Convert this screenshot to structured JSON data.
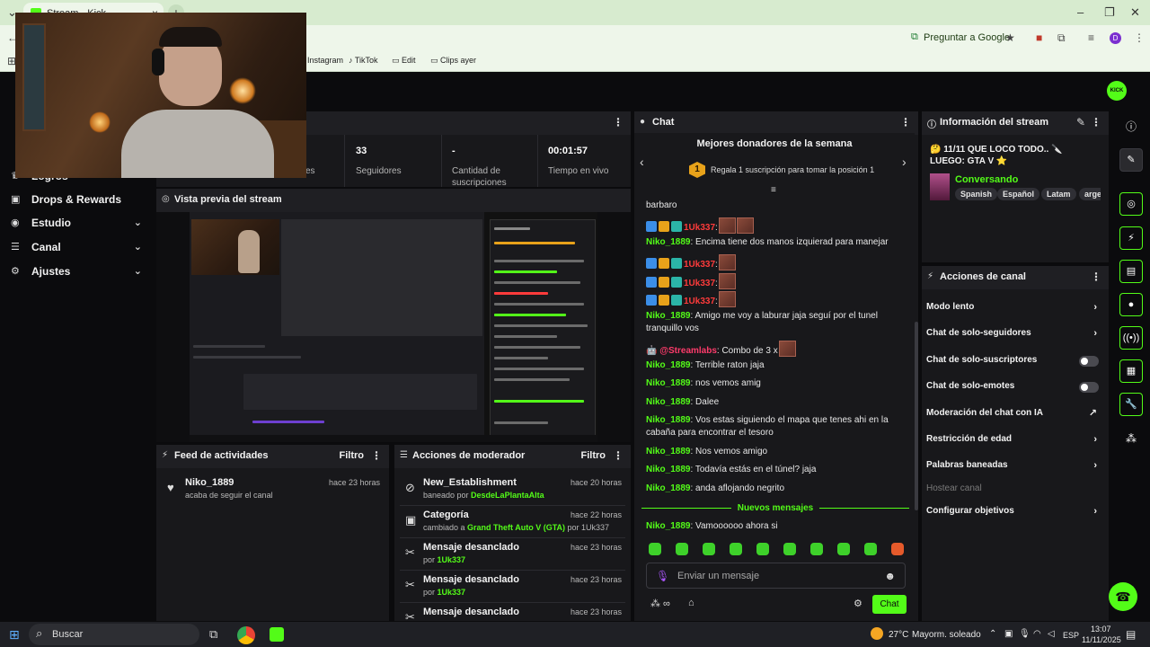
{
  "browser": {
    "tab_title": "Stream - Kick Dashboard",
    "ask_google": "Preguntar a Google",
    "bookmarks": [
      "Instagram",
      "TikTok",
      "Edit",
      "Clips ayer"
    ]
  },
  "sidebar": {
    "items": [
      {
        "label": "Logros",
        "icon": "trophy-icon"
      },
      {
        "label": "Drops & Rewards",
        "icon": "gift-icon"
      },
      {
        "label": "Estudio",
        "icon": "webcam-icon"
      },
      {
        "label": "Canal",
        "icon": "channel-icon"
      },
      {
        "label": "Ajustes",
        "icon": "gear-icon"
      }
    ]
  },
  "stats": [
    {
      "value": "",
      "label": "es"
    },
    {
      "value": "33",
      "label": "Seguidores"
    },
    {
      "value": "-",
      "label": "Cantidad de suscripciones"
    },
    {
      "value": "00:01:57",
      "label": "Tiempo en vivo"
    }
  ],
  "preview": {
    "title": "Vista previa del stream"
  },
  "activity_feed": {
    "title": "Feed de actividades",
    "filter": "Filtro",
    "items": [
      {
        "user": "Niko_1889",
        "text": "acaba de seguir el canal",
        "ago": "hace 23 horas"
      }
    ]
  },
  "moderator": {
    "title": "Acciones de moderador",
    "filter": "Filtro",
    "items": [
      {
        "title": "New_Establishment",
        "prefix": "baneado por ",
        "actor": "DesdeLaPlantaAlta",
        "suffix": "",
        "ago": "hace 20 horas"
      },
      {
        "title": "Categoría",
        "prefix": "cambiado a ",
        "actor": "Grand Theft Auto V (GTA)",
        "suffix": " por 1Uk337",
        "ago": "hace 22 horas"
      },
      {
        "title": "Mensaje desanclado",
        "prefix": "por ",
        "actor": "1Uk337",
        "suffix": "",
        "ago": "hace 23 horas"
      },
      {
        "title": "Mensaje desanclado",
        "prefix": "por ",
        "actor": "1Uk337",
        "suffix": "",
        "ago": "hace 23 horas"
      },
      {
        "title": "Mensaje desanclado",
        "prefix": "",
        "actor": "",
        "suffix": "",
        "ago": "hace 23 horas"
      }
    ]
  },
  "chat": {
    "title": "Chat",
    "donors_title": "Mejores donadores de la semana",
    "donors_msg": "Regala 1 suscripción para tomar la posición 1",
    "rank": "1",
    "messages": [
      {
        "user": "",
        "text": "barbaro"
      },
      {
        "user": "1Uk337",
        "text": ":",
        "badges": true,
        "emotes": 2,
        "red": true
      },
      {
        "user": "Niko_1889",
        "text": ": Encima tiene dos manos izquierad para manejar"
      },
      {
        "user": "1Uk337",
        "text": ":",
        "badges": true,
        "emotes": 1,
        "red": true
      },
      {
        "user": "1Uk337",
        "text": ":",
        "badges": true,
        "emotes": 1,
        "red": true
      },
      {
        "user": "1Uk337",
        "text": ":",
        "badges": true,
        "emotes": 1,
        "red": true
      },
      {
        "user": "Niko_1889",
        "text": ": Amigo me voy a laburar jaja seguí por el tunel tranquillo vos"
      },
      {
        "user": "@Streamlabs",
        "text": ": Combo de 3 x",
        "bot": true,
        "emotes": 1
      },
      {
        "user": "Niko_1889",
        "text": ": Terrible raton jaja"
      },
      {
        "user": "Niko_1889",
        "text": ": nos vemos amig"
      },
      {
        "user": "Niko_1889",
        "text": ": Dalee"
      },
      {
        "user": "Niko_1889",
        "text": ": Vos estas siguiendo el mapa que tenes ahi en la cabaña para encontrar el tesoro"
      },
      {
        "user": "Niko_1889",
        "text": ": Nos vemos amigo"
      },
      {
        "user": "Niko_1889",
        "text": ": Todavía estás en el túnel? jaja"
      },
      {
        "user": "Niko_1889",
        "text": ": anda aflojando negrito"
      }
    ],
    "new_messages": "Nuevos mensajes",
    "last_message": {
      "user": "Niko_1889",
      "text": ": Vamoooooo ahora si"
    },
    "input_placeholder": "Enviar un mensaje",
    "send_label": "Chat"
  },
  "stream_info": {
    "title": "Información del stream",
    "stream_title": "🤔 11/11 QUE LOCO TODO.. 🔪 LUEGO: GTA V ⭐",
    "category": "Conversando",
    "tags": [
      "Spanish",
      "Español",
      "Latam",
      "argen"
    ]
  },
  "channel_actions": {
    "title": "Acciones de canal",
    "items": [
      {
        "label": "Modo lento",
        "type": "chevron"
      },
      {
        "label": "Chat de solo-seguidores",
        "type": "chevron"
      },
      {
        "label": "Chat de solo-suscriptores",
        "type": "toggle"
      },
      {
        "label": "Chat de solo-emotes",
        "type": "toggle"
      },
      {
        "label": "Moderación del chat con IA",
        "type": "external"
      },
      {
        "label": "Restricción de edad",
        "type": "chevron"
      },
      {
        "label": "Palabras baneadas",
        "type": "chevron"
      },
      {
        "label": "Hostear canal",
        "type": "disabled"
      },
      {
        "label": "Configurar objetivos",
        "type": "chevron"
      }
    ]
  },
  "taskbar": {
    "search": "Buscar",
    "weather": "27°C",
    "weather_desc": "Mayorm. soleado",
    "lang": "ESP",
    "time": "13:07",
    "date": "11/11/2025"
  },
  "colors": {
    "accent": "#53fc18",
    "background": "#0b0b0d",
    "panel": "#18181b",
    "mod_red": "#ff3b3b"
  }
}
